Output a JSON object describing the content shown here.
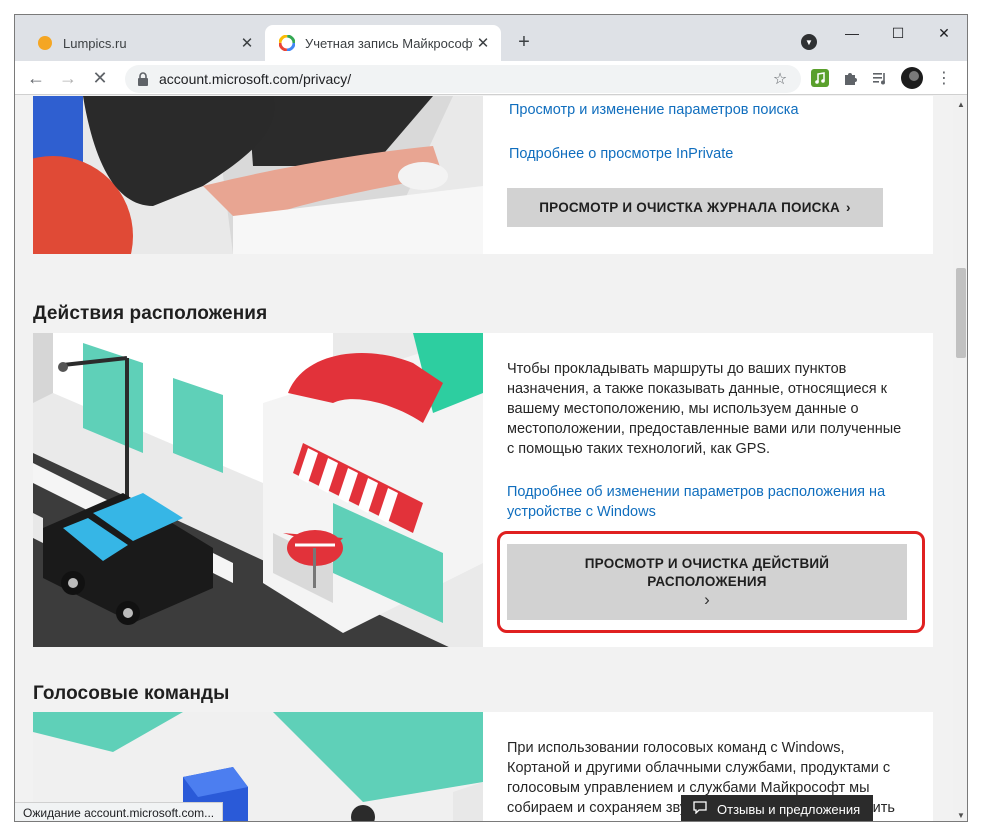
{
  "browser": {
    "tabs": [
      {
        "title": "Lumpics.ru",
        "active": false,
        "favicon": "orange-circle-icon"
      },
      {
        "title": "Учетная запись Майкрософт | К",
        "active": true,
        "favicon": "microsoft-account-icon"
      }
    ],
    "close_glyph": "✕",
    "new_tab_glyph": "+",
    "window_controls": {
      "minimize": "—",
      "maximize": "☐",
      "close": "✕"
    },
    "url": "account.microsoft.com/privacy/",
    "status_text": "Ожидание account.microsoft.com..."
  },
  "search_section": {
    "links": [
      "Просмотр и изменение параметров поиска",
      "Подробнее о просмотре InPrivate"
    ],
    "button_label": "ПРОСМОТР И ОЧИСТКА ЖУРНАЛА ПОИСКА",
    "chevron": "›"
  },
  "location_section": {
    "title": "Действия расположения",
    "description": "Чтобы прокладывать маршруты до ваших пунктов назначения, а также показывать данные, относящиеся к вашему местоположению, мы используем данные о местоположении, предоставленные вами или полученные с помощью таких технологий, как GPS.",
    "link": "Подробнее об изменении параметров расположения на устройстве с Windows",
    "button_line1": "ПРОСМОТР И ОЧИСТКА ДЕЙСТВИЙ",
    "button_line2": "РАСПОЛОЖЕНИЯ",
    "chevron": "›"
  },
  "voice_section": {
    "title": "Голосовые команды",
    "description": "При использовании голосовых команд с Windows, Кортаной и другими облачными службами, продуктами с голосовым управлением и службами Майкрософт мы собираем и сохраняем звуковые записи, чтобы улучшить распознавание речи и др"
  },
  "feedback_label": "Отзывы и предложения",
  "colors": {
    "accent_link": "#106ebe",
    "highlight": "#e02020",
    "button": "#d2d2d2"
  }
}
